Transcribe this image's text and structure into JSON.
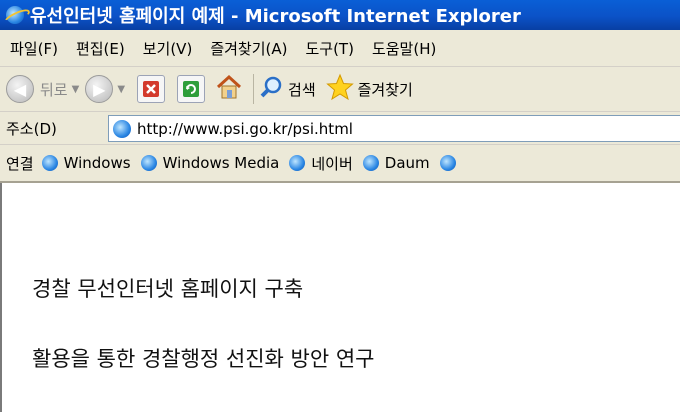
{
  "window": {
    "title": "유선인터넷 홈페이지 예제 - Microsoft Internet Explorer"
  },
  "menu": [
    "파일(F)",
    "편집(E)",
    "보기(V)",
    "즐겨찾기(A)",
    "도구(T)",
    "도움말(H)"
  ],
  "toolbar": {
    "back_label": "뒤로",
    "search_label": "검색",
    "favorites_label": "즐겨찾기"
  },
  "address": {
    "label": "주소(D)",
    "url": "http://www.psi.go.kr/psi.html"
  },
  "links": {
    "label": "연결",
    "items": [
      "Windows",
      "Windows Media",
      "네이버",
      "Daum"
    ]
  },
  "content": {
    "line1": "경찰 무선인터넷 홈페이지 구축",
    "line2": "활용을 통한 경찰행정 선진화 방안 연구"
  },
  "colors": {
    "titlebar": "#0b52c7",
    "chrome": "#ece9d8"
  }
}
